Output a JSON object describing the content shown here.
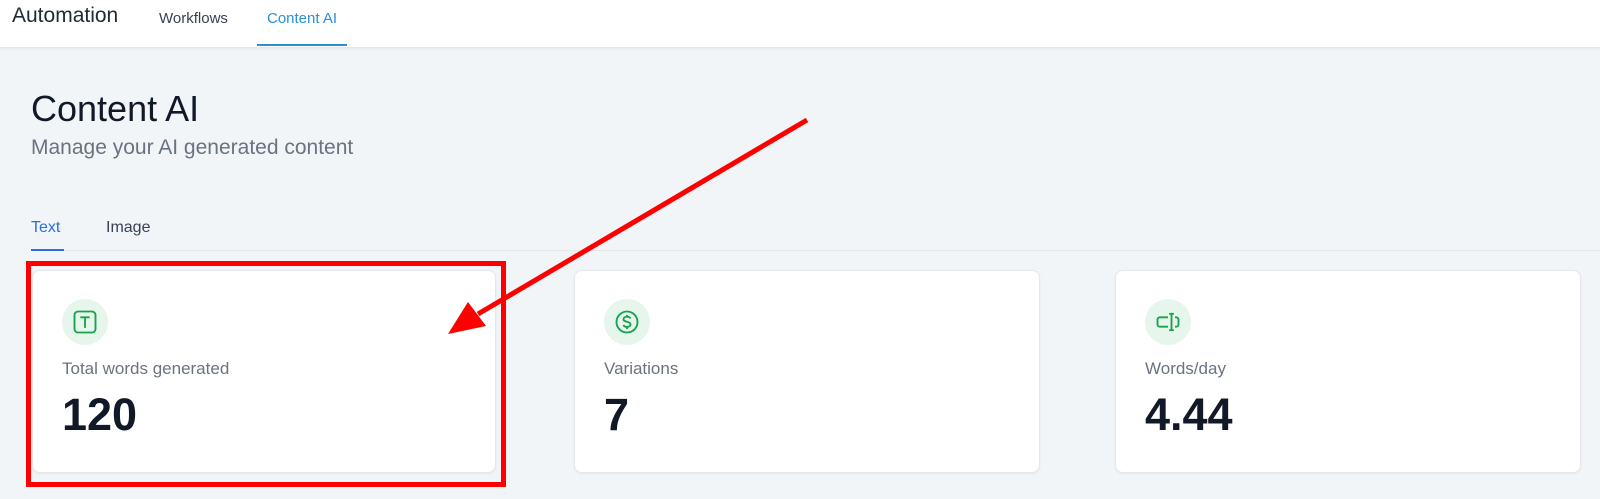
{
  "header": {
    "app_title": "Automation",
    "tabs": [
      {
        "label": "Workflows",
        "active": false
      },
      {
        "label": "Content AI",
        "active": true
      }
    ]
  },
  "page": {
    "title": "Content AI",
    "subtitle": "Manage your AI generated content"
  },
  "sub_tabs": [
    {
      "label": "Text",
      "active": true
    },
    {
      "label": "Image",
      "active": false
    }
  ],
  "stats": [
    {
      "label": "Total words generated",
      "value": "120",
      "icon": "text-icon"
    },
    {
      "label": "Variations",
      "value": "7",
      "icon": "dollar-icon"
    },
    {
      "label": "Words/day",
      "value": "4.44",
      "icon": "text-cursor-icon"
    }
  ],
  "colors": {
    "accent": "#2b8fd6",
    "icon_green": "#16a34a",
    "icon_bg": "#e6f6ec",
    "annotation_red": "#ff0000"
  }
}
